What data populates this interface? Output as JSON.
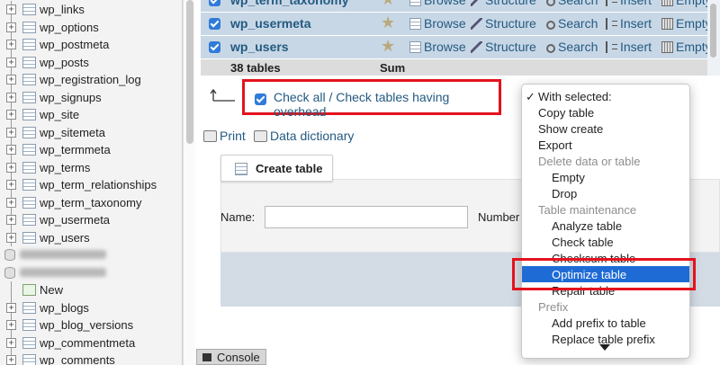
{
  "sidebar": {
    "items": [
      {
        "label": "wp_links",
        "kind": "table"
      },
      {
        "label": "wp_options",
        "kind": "table"
      },
      {
        "label": "wp_postmeta",
        "kind": "table"
      },
      {
        "label": "wp_posts",
        "kind": "table"
      },
      {
        "label": "wp_registration_log",
        "kind": "table"
      },
      {
        "label": "wp_signups",
        "kind": "table"
      },
      {
        "label": "wp_site",
        "kind": "table"
      },
      {
        "label": "wp_sitemeta",
        "kind": "table"
      },
      {
        "label": "wp_termmeta",
        "kind": "table"
      },
      {
        "label": "wp_terms",
        "kind": "table"
      },
      {
        "label": "wp_term_relationships",
        "kind": "table"
      },
      {
        "label": "wp_term_taxonomy",
        "kind": "table"
      },
      {
        "label": "wp_usermeta",
        "kind": "table"
      },
      {
        "label": "wp_users",
        "kind": "table"
      },
      {
        "label": "",
        "kind": "db-redacted"
      },
      {
        "label": "",
        "kind": "db-redacted"
      },
      {
        "label": "New",
        "kind": "new"
      },
      {
        "label": "wp_blogs",
        "kind": "table"
      },
      {
        "label": "wp_blog_versions",
        "kind": "table"
      },
      {
        "label": "wp_commentmeta",
        "kind": "table"
      },
      {
        "label": "wp_comments",
        "kind": "table"
      }
    ]
  },
  "tables": {
    "rows": [
      {
        "name": "wp_term_taxonomy"
      },
      {
        "name": "wp_usermeta"
      },
      {
        "name": "wp_users"
      }
    ],
    "actions": [
      "Browse",
      "Structure",
      "Search",
      "Insert",
      "Empty"
    ],
    "summary": {
      "count": "38 tables",
      "sum": "Sum"
    }
  },
  "check_all": {
    "label": "Check all / Check tables having overhead"
  },
  "links": {
    "print": "Print",
    "data_dictionary": "Data dictionary"
  },
  "create_table": {
    "tab_label": "Create table",
    "name_label": "Name:",
    "name_value": "",
    "number_label": "Number"
  },
  "console": {
    "label": "Console"
  },
  "dropdown": {
    "options": [
      {
        "label": "With selected:",
        "type": "header",
        "checked": true
      },
      {
        "label": "Copy table",
        "type": "option",
        "indent": 0
      },
      {
        "label": "Show create",
        "type": "option",
        "indent": 0
      },
      {
        "label": "Export",
        "type": "option",
        "indent": 0
      },
      {
        "label": "Delete data or table",
        "type": "group"
      },
      {
        "label": "Empty",
        "type": "option",
        "indent": 1
      },
      {
        "label": "Drop",
        "type": "option",
        "indent": 1
      },
      {
        "label": "Table maintenance",
        "type": "group"
      },
      {
        "label": "Analyze table",
        "type": "option",
        "indent": 1
      },
      {
        "label": "Check table",
        "type": "option",
        "indent": 1
      },
      {
        "label": "Checksum table",
        "type": "option",
        "indent": 1
      },
      {
        "label": "Optimize table",
        "type": "option",
        "indent": 1,
        "highlighted": true
      },
      {
        "label": "Repair table",
        "type": "option",
        "indent": 1
      },
      {
        "label": "Prefix",
        "type": "group"
      },
      {
        "label": "Add prefix to table",
        "type": "option",
        "indent": 1
      },
      {
        "label": "Replace table prefix",
        "type": "option",
        "indent": 1
      }
    ]
  },
  "colors": {
    "accent": "#e4121d",
    "highlight": "#1e6bd6",
    "link": "#235a81",
    "row_bg": "#c8d7e6"
  }
}
